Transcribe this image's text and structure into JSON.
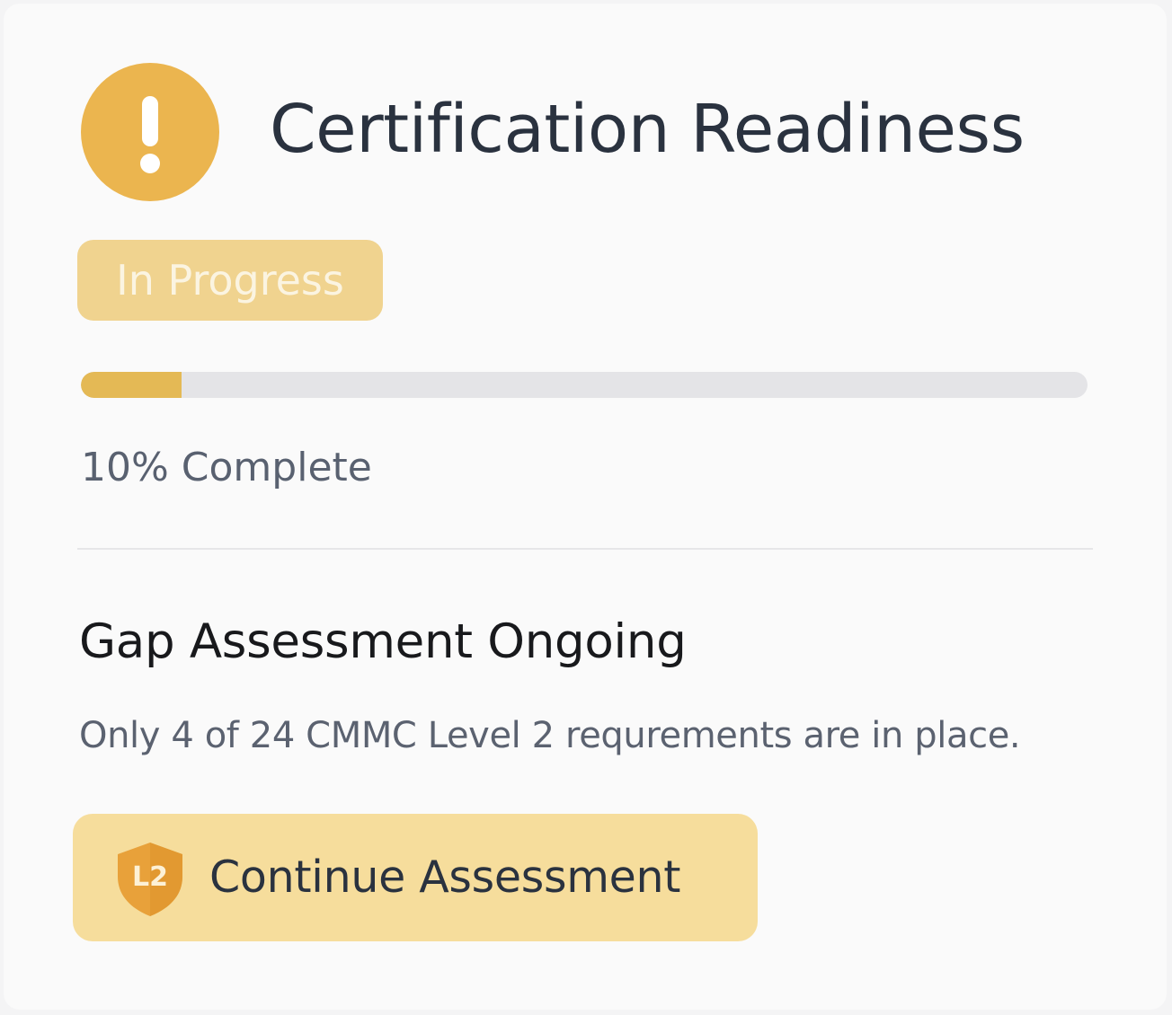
{
  "card": {
    "title": "Certification Readiness",
    "alert_icon": "exclamation-circle-icon",
    "status_badge": "In Progress",
    "progress": {
      "percent": 10,
      "label": "10% Complete"
    },
    "section_title": "Gap Assessment Ongoing",
    "description": "Only 4 of 24 CMMC Level 2 requrements are in place.",
    "button": {
      "label": "Continue Assessment",
      "icon": "shield-icon",
      "icon_text": "L2"
    }
  },
  "colors": {
    "accent": "#ebb54f",
    "progress_fill": "#e4b955",
    "track": "#e4e4e7",
    "badge_bg": "#f0d38f",
    "button_bg": "#f6dd9c",
    "title_text": "#2a323f"
  }
}
